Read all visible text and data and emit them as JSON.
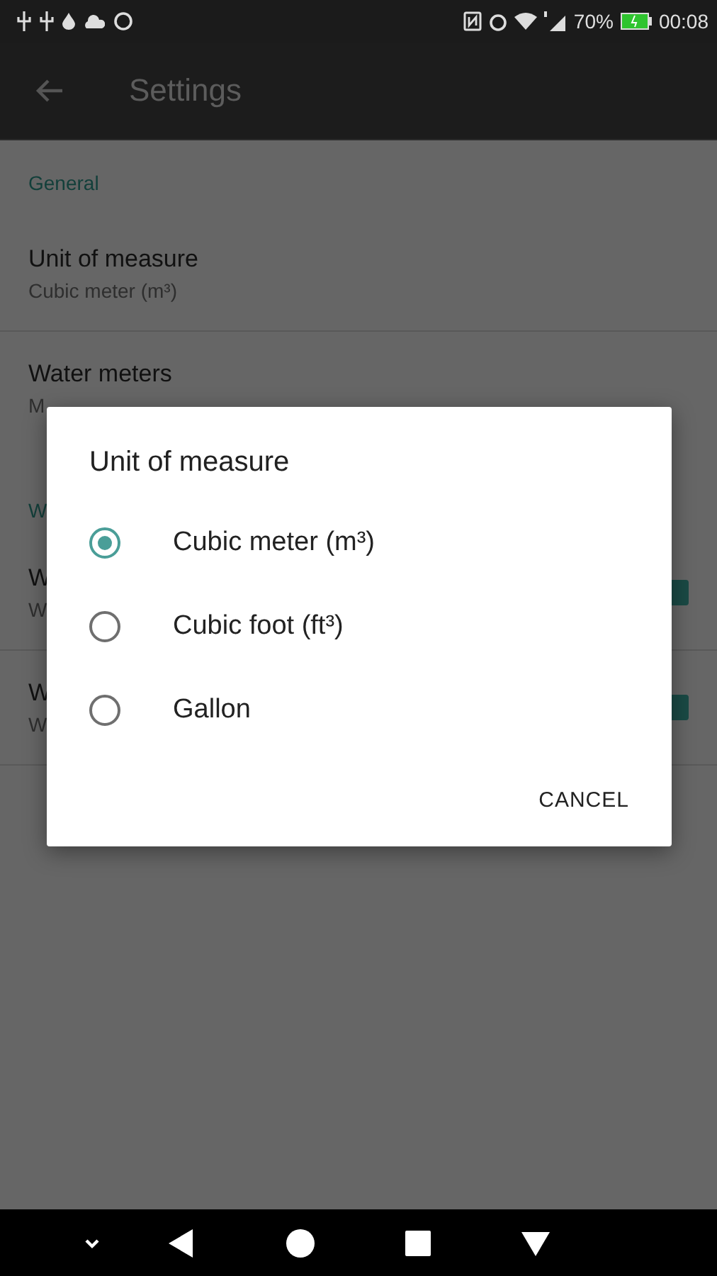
{
  "status_bar": {
    "battery": "70%",
    "time": "00:08"
  },
  "app_bar": {
    "title": "Settings"
  },
  "settings": [
    {
      "kind": "header",
      "title": "General"
    },
    {
      "kind": "item",
      "title": "Unit of measure",
      "subtitle": "Cubic meter (m³)"
    },
    {
      "kind": "item",
      "title": "Water meters",
      "subtitle": "M"
    },
    {
      "kind": "header",
      "title": "W"
    },
    {
      "kind": "check",
      "title": "W",
      "subtitle": "W",
      "checked": true
    },
    {
      "kind": "check",
      "title": "W",
      "subtitle": "W",
      "checked": true
    }
  ],
  "dialog": {
    "title": "Unit of measure",
    "options": [
      {
        "label": "Cubic meter (m³)",
        "selected": true
      },
      {
        "label": "Cubic foot (ft³)",
        "selected": false
      },
      {
        "label": "Gallon",
        "selected": false
      }
    ],
    "buttons": [
      "CANCEL"
    ]
  }
}
